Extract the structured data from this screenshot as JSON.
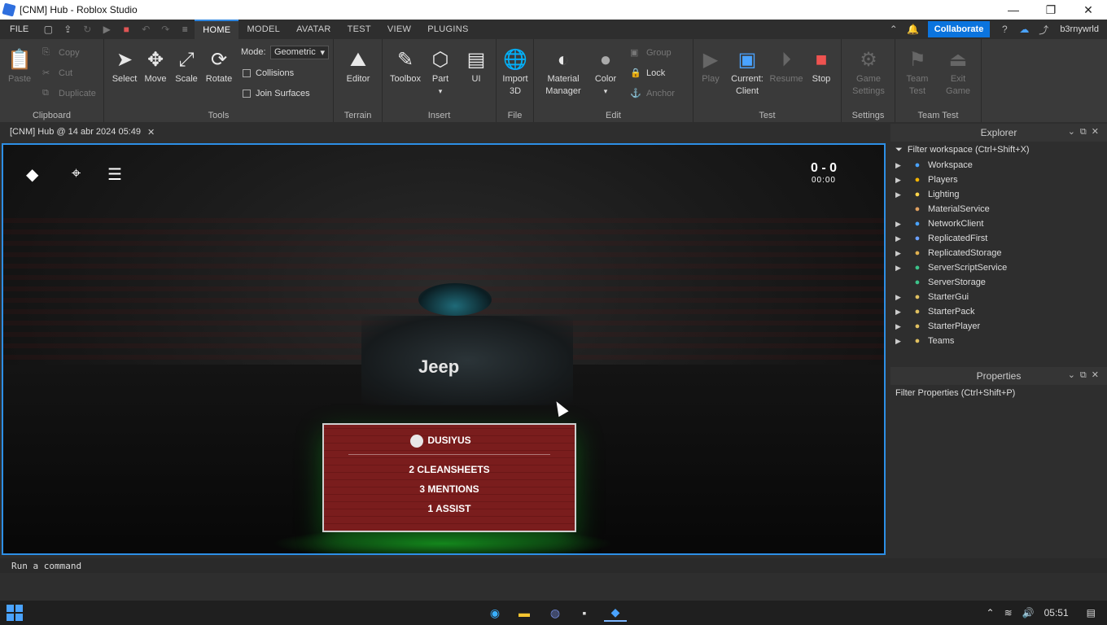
{
  "window": {
    "title": "[CNM] Hub - Roblox Studio"
  },
  "menu": {
    "file": "FILE",
    "tabs": [
      "HOME",
      "MODEL",
      "AVATAR",
      "TEST",
      "VIEW",
      "PLUGINS"
    ],
    "collaborate": "Collaborate",
    "username": "b3rnywrld"
  },
  "ribbon": {
    "clipboard": {
      "label": "Clipboard",
      "paste": "Paste",
      "copy": "Copy",
      "cut": "Cut",
      "duplicate": "Duplicate"
    },
    "tools": {
      "label": "Tools",
      "select": "Select",
      "move": "Move",
      "scale": "Scale",
      "rotate": "Rotate",
      "mode_label": "Mode:",
      "mode_value": "Geometric",
      "collisions": "Collisions",
      "join_surfaces": "Join Surfaces"
    },
    "terrain": {
      "label": "Terrain",
      "editor": "Editor"
    },
    "insert": {
      "label": "Insert",
      "toolbox": "Toolbox",
      "part": "Part",
      "ui": "UI"
    },
    "file": {
      "label": "File",
      "import1": "Import",
      "import2": "3D"
    },
    "edit": {
      "label": "Edit",
      "material1": "Material",
      "material2": "Manager",
      "color": "Color",
      "group": "Group",
      "lock": "Lock",
      "anchor": "Anchor"
    },
    "test": {
      "label": "Test",
      "play": "Play",
      "current1": "Current:",
      "current2": "Client",
      "resume": "Resume",
      "stop": "Stop"
    },
    "settings": {
      "label": "Settings",
      "game1": "Game",
      "game2": "Settings"
    },
    "teamtest": {
      "label": "Team Test",
      "team1": "Team",
      "team2": "Test",
      "exit1": "Exit",
      "exit2": "Game"
    }
  },
  "document_tab": "[CNM] Hub @ 14 abr 2024 05:49",
  "viewport": {
    "score_top": "0 - 0",
    "score_sub": "00:00",
    "shirt_text": "Jeep",
    "board": {
      "name": "DUSIYUS",
      "stats": [
        "2 CLEANSHEETS",
        "3 MENTIONS",
        "1 ASSIST"
      ]
    }
  },
  "explorer": {
    "title": "Explorer",
    "filter": "Filter workspace (Ctrl+Shift+X)",
    "items": [
      {
        "label": "Workspace",
        "icon": "globe-icon",
        "color": "#4aa3ff",
        "expand": true
      },
      {
        "label": "Players",
        "icon": "players-icon",
        "color": "#f4b400",
        "expand": true
      },
      {
        "label": "Lighting",
        "icon": "bulb-icon",
        "color": "#ffd54a",
        "expand": true
      },
      {
        "label": "MaterialService",
        "icon": "material-icon",
        "color": "#e0a060",
        "expand": false
      },
      {
        "label": "NetworkClient",
        "icon": "network-icon",
        "color": "#4aa3ff",
        "expand": true
      },
      {
        "label": "ReplicatedFirst",
        "icon": "replicated-icon",
        "color": "#6aa0ff",
        "expand": true
      },
      {
        "label": "ReplicatedStorage",
        "icon": "storage-icon",
        "color": "#e0b050",
        "expand": true
      },
      {
        "label": "ServerScriptService",
        "icon": "server-script-icon",
        "color": "#3cc38a",
        "expand": true
      },
      {
        "label": "ServerStorage",
        "icon": "server-storage-icon",
        "color": "#3cc38a",
        "expand": false
      },
      {
        "label": "StarterGui",
        "icon": "folder-icon",
        "color": "#e0c060",
        "expand": true
      },
      {
        "label": "StarterPack",
        "icon": "folder-icon",
        "color": "#e0c060",
        "expand": true
      },
      {
        "label": "StarterPlayer",
        "icon": "folder-icon",
        "color": "#e0c060",
        "expand": true
      },
      {
        "label": "Teams",
        "icon": "folder-icon",
        "color": "#e0c060",
        "expand": true
      }
    ]
  },
  "properties": {
    "title": "Properties",
    "filter": "Filter Properties (Ctrl+Shift+P)"
  },
  "command_bar": {
    "placeholder": "Run a command"
  },
  "taskbar": {
    "time": "05:51"
  }
}
